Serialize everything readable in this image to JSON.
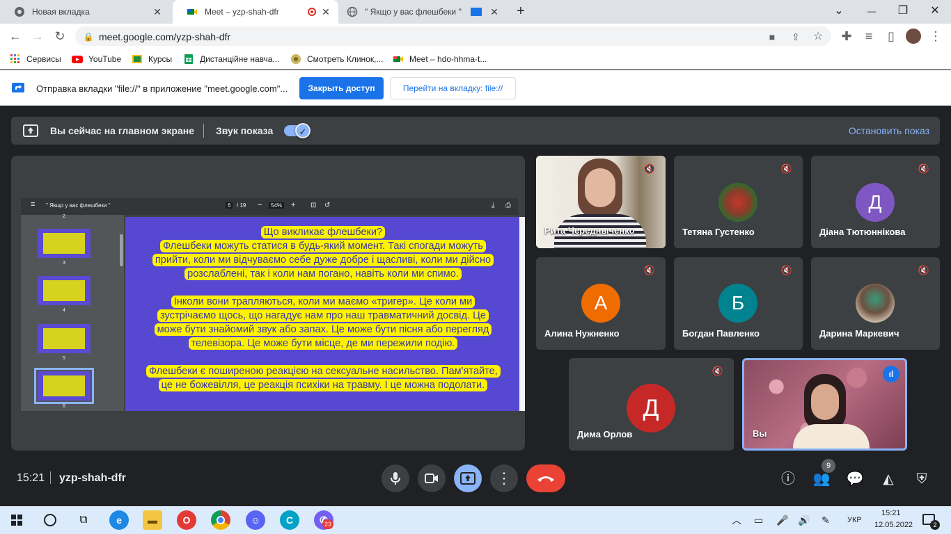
{
  "browser": {
    "tabs": [
      {
        "title": "Новая вкладка",
        "icon": "chrome-icon"
      },
      {
        "title": "Meet – yzp-shah-dfr",
        "icon": "meet-icon",
        "recording": true
      },
      {
        "title": "\" Якщо у вас флешбеки \"",
        "icon": "globe-icon"
      }
    ],
    "new_tab": "+",
    "window_controls": {
      "minimize": "—",
      "restore": "❐",
      "close": "✕",
      "tab_search": "⌄"
    },
    "url": "meet.google.com/yzp-shah-dfr",
    "bookmarks": [
      {
        "label": "Сервисы",
        "icon": "apps-grid-icon"
      },
      {
        "label": "YouTube",
        "icon": "youtube-icon"
      },
      {
        "label": "Курсы",
        "icon": "classroom-icon"
      },
      {
        "label": "Дистанційне навча...",
        "icon": "sheets-icon"
      },
      {
        "label": "Смотреть Клинок,...",
        "icon": "site-icon"
      },
      {
        "label": "Meet – hdo-hhma-t...",
        "icon": "meet-icon"
      }
    ],
    "infobar": {
      "message": "Отправка вкладки \"file://\" в приложение \"meet.google.com\"...",
      "primary": "Закрыть доступ",
      "secondary": "Перейти на вкладку: file://"
    }
  },
  "meet": {
    "presenting_banner": {
      "text": "Вы сейчас на главном экране",
      "audio_label": "Звук показа",
      "audio_on": true,
      "stop": "Остановить показ"
    },
    "pdf": {
      "title": "\" Якщо у вас флешбеки \"",
      "page": "6",
      "total": "/ 19",
      "zoom": "54%",
      "thumb_labels": [
        "2",
        "3",
        "4",
        "5",
        "6"
      ],
      "slide_heading": "Що викликає флешбеки?",
      "slide_paragraphs": [
        "Флешбеки можуть статися в будь-який момент. Такі спогади можуть прийти, коли ми відчуваємо себе дуже добре і щасливі, коли ми дійсно розслаблені, так і коли нам погано, навіть коли ми спимо.",
        "Інколи вони трапляються, коли ми маємо «тригер». Це коли ми зустрічаємо щось, що нагадує нам про наш травматичний досвід. Це може бути знайомий звук або запах. Це може бути пісня або перегляд телевізора. Це може бути місце, де ми пережили подію.",
        "Флешбеки є поширеною реакцією на сексуальне насильство. Пам'ятайте, це не божевілля, це реакція психіки на травму. І це можна подолати."
      ]
    },
    "participants": [
      {
        "name": "Рита Чередныченко",
        "type": "video",
        "muted": true
      },
      {
        "name": "Тетяна Густенко",
        "type": "photo",
        "muted": true
      },
      {
        "name": "Діана Тютюннікова",
        "initial": "Д",
        "color": "#7e57c2",
        "muted": true
      },
      {
        "name": "Алина Нужненко",
        "initial": "А",
        "color": "#ef6c00",
        "muted": true
      },
      {
        "name": "Богдан Павленко",
        "initial": "Б",
        "color": "#00838f",
        "muted": true
      },
      {
        "name": "Дарина Маркевич",
        "type": "photo",
        "muted": true
      },
      {
        "name": "Дима Орлов",
        "initial": "Д",
        "color": "#c62828",
        "muted": true
      },
      {
        "name": "Вы",
        "type": "video",
        "speaking": true
      }
    ],
    "time": "15:21",
    "meeting_code": "yzp-shah-dfr",
    "people_count": "9"
  },
  "taskbar": {
    "lang": "УКР",
    "time": "15:21",
    "date": "12.05.2022",
    "viber_badge": "23",
    "notif_count": "2"
  }
}
